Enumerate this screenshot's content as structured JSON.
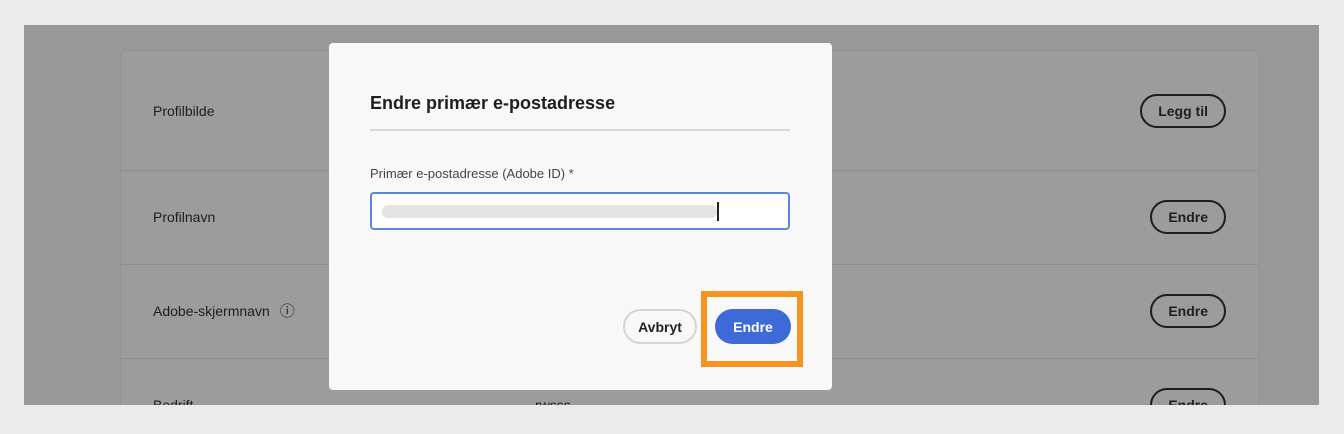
{
  "rows": [
    {
      "label": "Profilbilde",
      "value": "",
      "button": "Legg til"
    },
    {
      "label": "Profilnavn",
      "value": "",
      "button": "Endre"
    },
    {
      "label": "Adobe-skjermnavn",
      "value": "",
      "button": "Endre",
      "info_icon": "ⓘ"
    },
    {
      "label": "Bedrift",
      "value": "rwsss",
      "button": "Endre"
    }
  ],
  "dialog": {
    "title": "Endre primær e-postadresse",
    "field_label": "Primær e-postadresse (Adobe ID) *",
    "cancel": "Avbryt",
    "confirm": "Endre",
    "highlight_color": "#f7941d",
    "accent": "#3e6ad8"
  }
}
